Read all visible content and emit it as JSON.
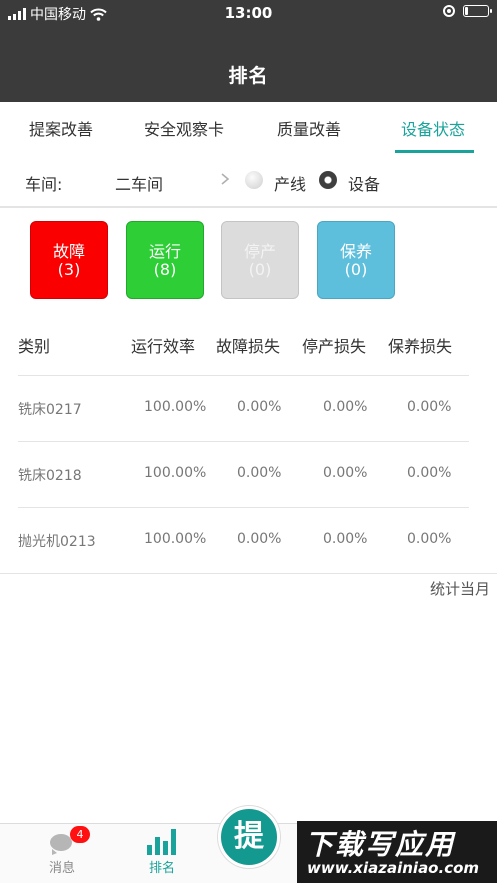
{
  "status_bar": {
    "carrier": "中国移动",
    "time": "13:00",
    "battery_level": 0.15
  },
  "nav": {
    "title": "排名"
  },
  "tabs": [
    {
      "label": "提案改善",
      "active": false
    },
    {
      "label": "安全观察卡",
      "active": false
    },
    {
      "label": "质量改善",
      "active": false
    },
    {
      "label": "设备状态",
      "active": true
    }
  ],
  "filter": {
    "workshop_label": "车间:",
    "workshop_value": "二车间",
    "options": [
      {
        "label": "产线",
        "selected": false
      },
      {
        "label": "设备",
        "selected": true
      }
    ]
  },
  "status_cards": [
    {
      "label": "故障",
      "count": "(3)",
      "color": "#fb0000"
    },
    {
      "label": "运行",
      "count": "(8)",
      "color": "#2dce36"
    },
    {
      "label": "停产",
      "count": "(0)",
      "color": "#dcdcdc"
    },
    {
      "label": "保养",
      "count": "(0)",
      "color": "#5ebfdc"
    }
  ],
  "table": {
    "headers": [
      "类别",
      "运行效率",
      "故障损失",
      "停产损失",
      "保养损失"
    ],
    "rows": [
      [
        "铣床0217",
        "100.00%",
        "0.00%",
        "0.00%",
        "0.00%"
      ],
      [
        "铣床0218",
        "100.00%",
        "0.00%",
        "0.00%",
        "0.00%"
      ],
      [
        "抛光机0213",
        "100.00%",
        "0.00%",
        "0.00%",
        "0.00%"
      ]
    ]
  },
  "footnote": "统计当月",
  "bottom_nav": {
    "items": [
      {
        "label": "消息",
        "badge": "4",
        "icon": "chat-bubble-icon"
      },
      {
        "label": "排名",
        "icon": "bar-chart-icon",
        "active": true
      }
    ],
    "fab_label": "提"
  },
  "watermark": {
    "main": "下载写应用",
    "url": "www.xiazainiao.com"
  },
  "colors": {
    "accent": "#1aa39a",
    "header_bg": "#3b3b3b"
  }
}
